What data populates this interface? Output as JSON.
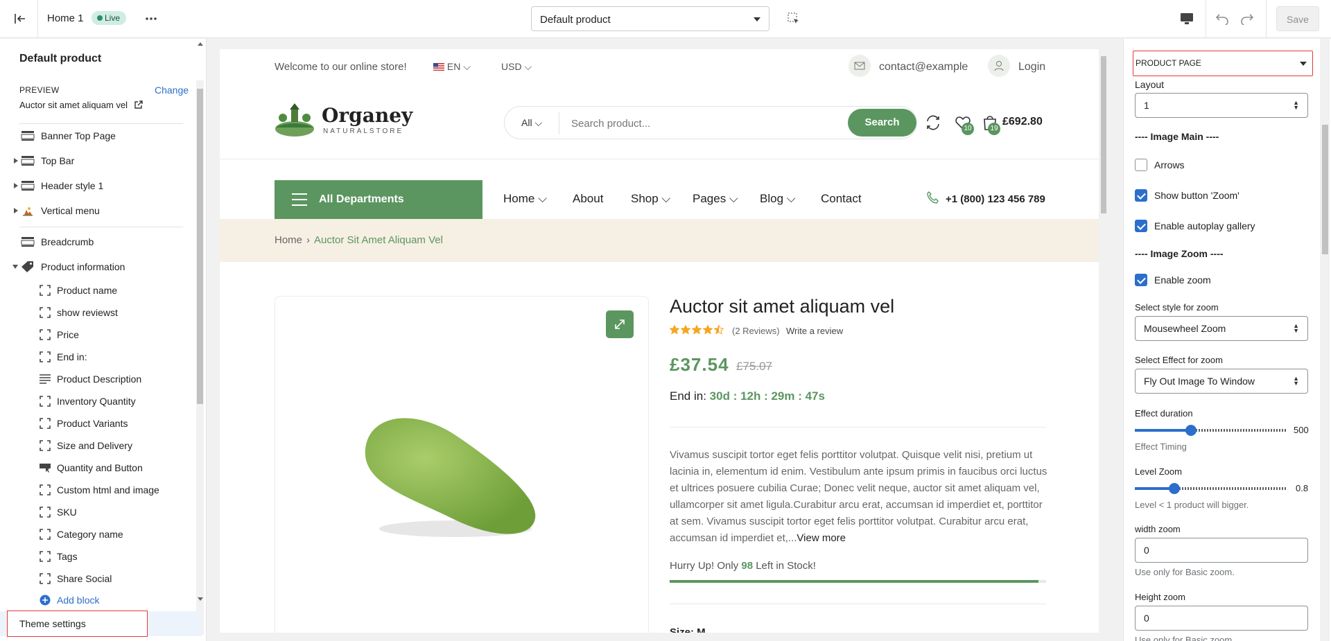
{
  "topbar": {
    "title": "Home 1",
    "live_badge": "Live",
    "template_select": "Default product",
    "save_label": "Save"
  },
  "left_sidebar": {
    "title": "Default product",
    "preview_label": "PREVIEW",
    "change_link": "Change",
    "preview_value": "Auctor sit amet aliquam vel",
    "sections": [
      {
        "label": "Banner Top Page",
        "icon": "section-icon"
      },
      {
        "label": "Top Bar",
        "icon": "section-icon"
      },
      {
        "label": "Header style 1",
        "icon": "section-icon"
      },
      {
        "label": "Vertical menu",
        "icon": "image-icon"
      },
      {
        "label": "Breadcrumb",
        "icon": "section-icon"
      },
      {
        "label": "Product information",
        "icon": "tag-icon"
      }
    ],
    "blocks": [
      "Product name",
      "show reviewst",
      "Price",
      "End in:",
      "Product Description",
      "Inventory Quantity",
      "Product Variants",
      "Size and Delivery",
      "Quantity and Button",
      "Custom html and image",
      "SKU",
      "Category name",
      "Tags",
      "Share Social"
    ],
    "add_block": "Add block",
    "theme_settings": "Theme settings"
  },
  "preview": {
    "welcome": "Welcome to our online store!",
    "language": "EN",
    "currency": "USD",
    "email": "contact@example",
    "login": "Login",
    "logo_name": "Organey",
    "logo_sub": "NATURALSTORE",
    "search_category": "All",
    "search_placeholder": "Search product...",
    "search_button": "Search",
    "wishlist_count": "10",
    "cart_count": "19",
    "cart_total": "£692.80",
    "all_departments": "All Departments",
    "nav": [
      "Home",
      "About",
      "Shop",
      "Pages",
      "Blog",
      "Contact"
    ],
    "phone": "+1 (800) 123 456 789",
    "breadcrumb_home": "Home",
    "breadcrumb_current": "Auctor Sit Amet Aliquam Vel",
    "product_title": "Auctor sit amet aliquam vel",
    "rating": 4.5,
    "reviews": "(2 Reviews)",
    "write_review": "Write a review",
    "price": "£37.54",
    "old_price": "£75.07",
    "end_in_label": "End in:",
    "countdown": "30d : 12h : 29m : 47s",
    "description": "Vivamus suscipit tortor eget felis porttitor volutpat. Quisque velit nisi, pretium ut lacinia in, elementum id enim. Vestibulum ante ipsum primis in faucibus orci luctus et ultrices posuere cubilia Curae; Donec velit neque, auctor sit amet aliquam vel, ullamcorper sit amet ligula.Curabitur arcu erat, accumsan id imperdiet et, porttitor at sem. Vivamus suscipit tortor eget felis porttitor volutpat. Curabitur arcu erat, accumsan id imperdiet et,...",
    "view_more": "View more",
    "stock_prefix": "Hurry Up! Only",
    "stock_count": "98",
    "stock_suffix": "Left in Stock!",
    "stock_fraction": 0.98,
    "size_label": "Size: M"
  },
  "right_sidebar": {
    "section_select": "PRODUCT PAGE",
    "layout_label": "Layout",
    "layout_value": "1",
    "image_main_heading": "---- Image Main ----",
    "arrows_label": "Arrows",
    "arrows_checked": false,
    "zoom_button_label": "Show button 'Zoom'",
    "zoom_button_checked": true,
    "autoplay_label": "Enable autoplay gallery",
    "autoplay_checked": true,
    "image_zoom_heading": "---- Image Zoom ----",
    "enable_zoom_label": "Enable zoom",
    "enable_zoom_checked": true,
    "zoom_style_label": "Select style for zoom",
    "zoom_style_value": "Mousewheel Zoom",
    "zoom_effect_label": "Select Effect for zoom",
    "zoom_effect_value": "Fly Out Image To Window",
    "effect_duration_label": "Effect duration",
    "effect_duration_value": "500",
    "effect_duration_fraction": 0.37,
    "effect_timing_help": "Effect Timing",
    "level_zoom_label": "Level Zoom",
    "level_zoom_value": "0.8",
    "level_zoom_fraction": 0.26,
    "level_zoom_help": "Level < 1 product will bigger.",
    "width_zoom_label": "width zoom",
    "width_zoom_value": "0",
    "width_zoom_help": "Use only for Basic zoom.",
    "height_zoom_label": "Height zoom",
    "height_zoom_value": "0",
    "height_zoom_help": "Use only for Basic zoom."
  }
}
